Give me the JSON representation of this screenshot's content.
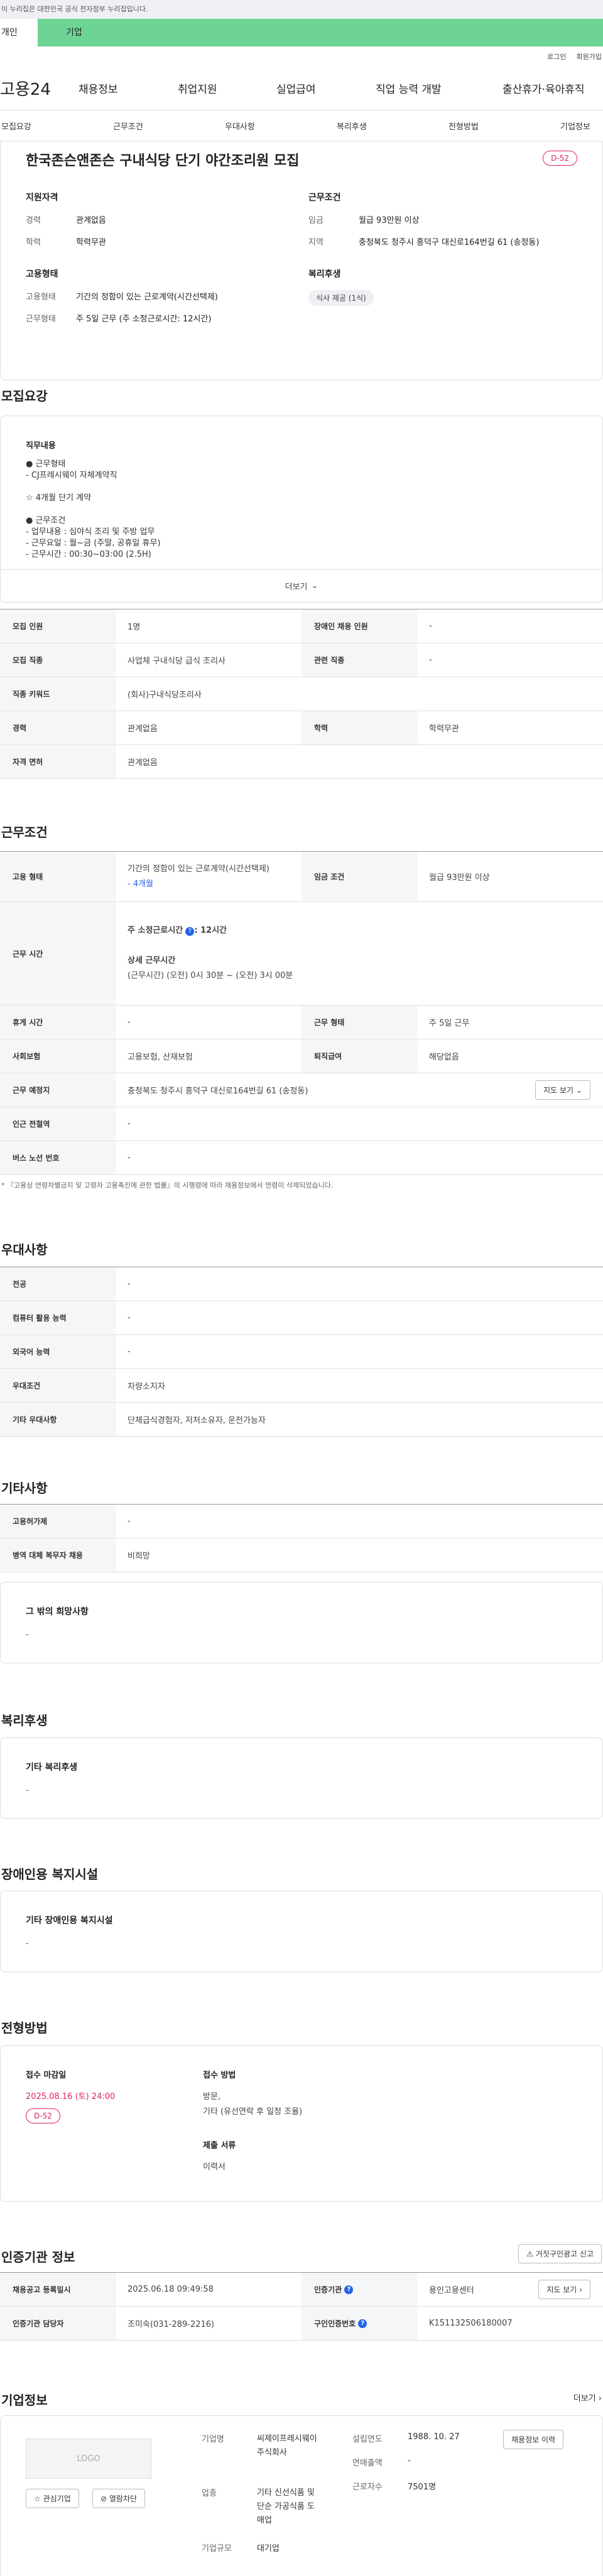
{
  "topbar": {
    "notice": "이 누리집은 대한민국 공식 전자정부 누리집입니다."
  },
  "tabs": [
    "개인",
    "기업"
  ],
  "util": [
    "로그인",
    "회원가입"
  ],
  "gnb": {
    "logo": "고용24",
    "menu": [
      "채용정보",
      "취업지원",
      "실업급여",
      "직업 능력 개발",
      "출산휴가·육아휴직"
    ]
  },
  "subnav": [
    "모집요강",
    "근무조건",
    "우대사항",
    "복리후생",
    "전형방법",
    "기업정보"
  ],
  "summary": {
    "title": "한국존슨앤존슨 구내식당 단기 야간조리원 모집",
    "dday": "D-52",
    "qual": {
      "title": "지원자격",
      "rows": [
        {
          "k": "경력",
          "v": "관계없음"
        },
        {
          "k": "학력",
          "v": "학력무관"
        }
      ]
    },
    "cond": {
      "title": "근무조건",
      "rows": [
        {
          "k": "임금",
          "v": "월급 93만원 이상"
        },
        {
          "k": "지역",
          "v": "충청북도 청주시 흥덕구 대신로164번길 61 (송정동)"
        }
      ]
    },
    "emp": {
      "title": "고용형태",
      "rows": [
        {
          "k": "고용형태",
          "v": "기간의 정함이 있는 근로계약(시간선택제)"
        },
        {
          "k": "근무형태",
          "v": "주 5일 근무 (주 소정근로시간: 12시간)"
        }
      ]
    },
    "welfare": {
      "title": "복리후생",
      "chip": "식사 제공 (1식)"
    }
  },
  "recruit": {
    "title": "모집요강",
    "job_title": "직무내용",
    "lines": [
      "● 근무형태",
      "- CJ프레시웨이 자체계약직",
      "",
      "☆ 4개월 단기 계약",
      "",
      "● 근무조건",
      "- 업무내용 : 심야식 조리 및 주방 업무",
      "- 근무요일 : 월~금 (주말, 공휴일 휴무)",
      "- 근무시간 : 00:30~03:00 (2.5H)"
    ],
    "more": "더보기",
    "rows": [
      {
        "k1": "모집 인원",
        "v1": "1명",
        "k2": "장애인 채용 인원",
        "v2": "-"
      },
      {
        "k1": "모집 직종",
        "v1": "사업체 구내식당 급식 조리사",
        "k2": "관련 직종",
        "v2": "-"
      },
      {
        "k1": "직종 키워드",
        "v1": "(회사)구내식당조리사"
      },
      {
        "k1": "경력",
        "v1": "관계없음",
        "k2": "학력",
        "v2": "학력무관"
      },
      {
        "k1": "자격 면허",
        "v1": "관계없음"
      }
    ]
  },
  "work": {
    "title": "근무조건",
    "emp_type_k": "고용 형태",
    "emp_type_v": "기간의 정함이 있는 근로계약(시간선택제)",
    "emp_type_sub": "- 4개월",
    "wage_k": "임금 조건",
    "wage_v": "월급 93만원 이상",
    "hours_k": "근무 시간",
    "hours_1": "주 소정근로시간",
    "hours_1v": ": 12시간",
    "hours_2": "상세 근무시간",
    "hours_3": "(근무시간) (오전) 0시 30분 ~ (오전) 3시 00분",
    "rows": [
      {
        "k1": "휴게 시간",
        "v1": "-",
        "k2": "근무 형태",
        "v2": "주 5일 근무"
      },
      {
        "k1": "사회보험",
        "v1": "고용보험, 산재보험",
        "k2": "퇴직급여",
        "v2": "해당없음"
      }
    ],
    "place_k": "근무 예정지",
    "place_v": "충청북도 청주시 흥덕구 대신로164번길 61 (송정동)",
    "map_btn": "지도 보기",
    "subway_k": "인근 전철역",
    "subway_v": "-",
    "bus_k": "버스 노선 번호",
    "bus_v": "-",
    "note": "* 『고용상 연령차별금지 및 고령자 고용촉진에 관한 법률』의 시행령에 따라 채용정보에서 연령이 삭제되었습니다."
  },
  "pref": {
    "title": "우대사항",
    "rows": [
      {
        "k": "전공",
        "v": "-"
      },
      {
        "k": "컴퓨터 활용 능력",
        "v": "-"
      },
      {
        "k": "외국어 능력",
        "v": "-"
      },
      {
        "k": "우대조건",
        "v": "차량소지자"
      },
      {
        "k": "기타 우대사항",
        "v": "단체급식경험자, 저처소유자, 운전가능자"
      }
    ]
  },
  "etc": {
    "title": "기타사항",
    "rows": [
      {
        "k": "고용허가제",
        "v": "-"
      },
      {
        "k": "병역 대체 복무자 채용",
        "v": "비희망"
      }
    ],
    "box_title": "그 밖의 희망사항",
    "box_v": "-"
  },
  "welfare": {
    "title": "복리후생",
    "box_title": "기타 복리후생",
    "box_v": "-"
  },
  "disabled": {
    "title": "장애인용 복지시설",
    "box_title": "기타 장애인용 복지시설",
    "box_v": "-"
  },
  "process": {
    "title": "전형방법",
    "deadline_k": "접수 마감일",
    "deadline_v": "2025.08.16 (토) 24:00",
    "dday": "D-52",
    "method_k": "접수 방법",
    "method_v1": "방문,",
    "method_v2": "기타 (유선연락 후 일정 조율)",
    "doc_k": "제출 서류",
    "doc_v": "이력서"
  },
  "cert": {
    "title": "인증기관 정보",
    "report_btn": "거짓구인광고 신고",
    "r1": {
      "k1": "채용공고 등록일시",
      "v1": "2025.06.18 09:49:58",
      "k2": "인증기관",
      "v2": "용인고용센터",
      "btn": "지도 보기"
    },
    "r2": {
      "k1": "인증기관 담당자",
      "v1": "조미숙(031-289-2216)",
      "k2": "구인인증번호",
      "v2": "K151132506180007"
    }
  },
  "company": {
    "title": "기업정보",
    "more": "더보기",
    "logo": "LOGO",
    "fav_btn": "관심기업",
    "block_btn": "열람차단",
    "name_k": "기업명",
    "name_v1": "씨제이프레시웨이",
    "name_v2": "주식회사",
    "biz_k": "업종",
    "biz_v1": "기타 신선식품 및",
    "biz_v2": "단순 가공식품 도",
    "biz_v3": "매업",
    "size_k": "기업규모",
    "size_v": "대기업",
    "est_k": "설립연도",
    "est_v": "1988. 10. 27",
    "sales_k": "연매출액",
    "sales_v": "-",
    "emp_k": "근로자수",
    "emp_v": "7501명",
    "jobs_btn": "채용정보 이력"
  }
}
